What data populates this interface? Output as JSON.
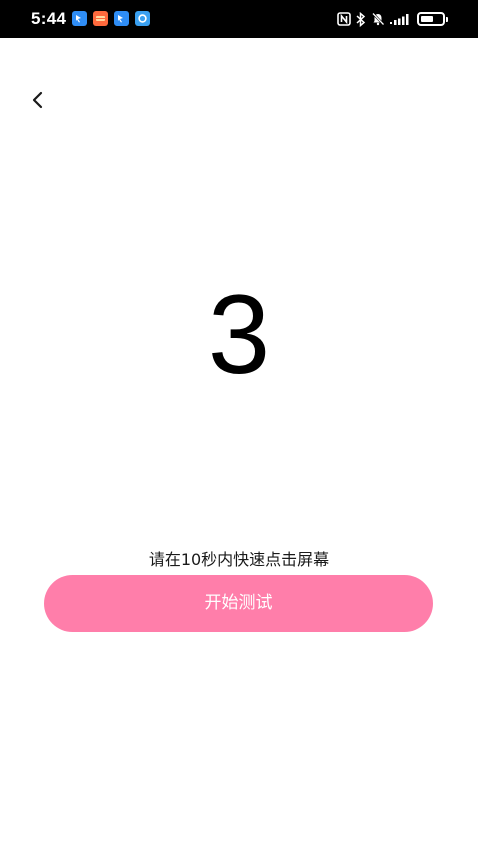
{
  "status_bar": {
    "time": "5:44",
    "notification_icons": [
      "app-blue-icon",
      "app-orange-icon",
      "app-blue-icon",
      "app-blue-round-icon"
    ],
    "system_icons": [
      "nfc-icon",
      "bluetooth-icon",
      "mute-icon",
      "signal-icon",
      "battery-icon"
    ],
    "battery_level": 0.6
  },
  "header": {
    "back_icon": "chevron-left-icon"
  },
  "main": {
    "countdown": "3",
    "instruction": "请在10秒内快速点击屏幕",
    "start_button_label": "开始测试"
  },
  "colors": {
    "status_bar_bg": "#000000",
    "button_bg": "#ff7eaa",
    "button_text": "#ffffff",
    "background": "#ffffff"
  }
}
